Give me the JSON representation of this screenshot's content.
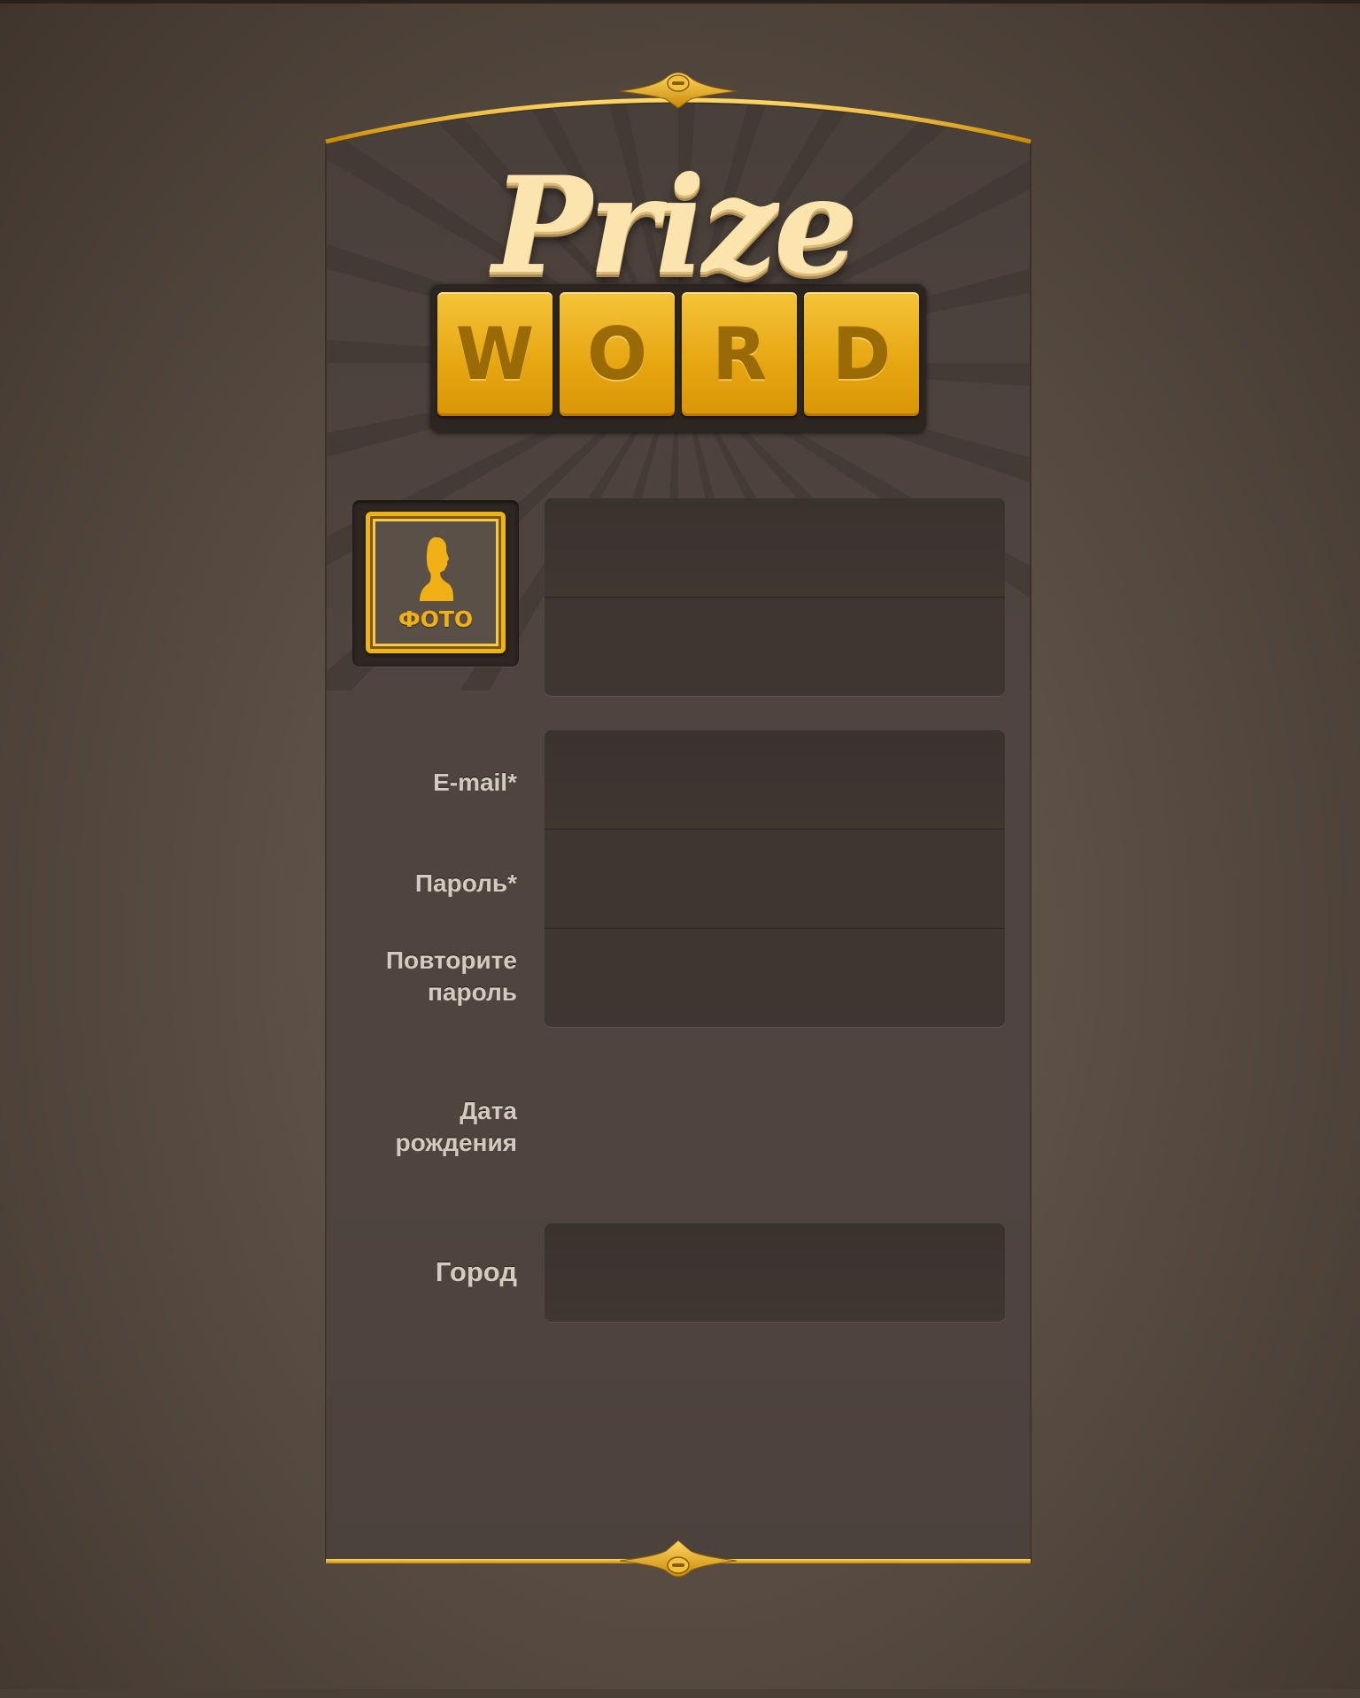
{
  "app": {
    "title": "Prize WORD"
  },
  "logo": {
    "script_text": "Prize",
    "tiles": [
      "W",
      "O",
      "R",
      "D"
    ]
  },
  "photo": {
    "label": "ФОТО"
  },
  "fields": {
    "first_name": {
      "value": "",
      "placeholder": ""
    },
    "last_name": {
      "value": "",
      "placeholder": ""
    },
    "email": {
      "label": "E-mail*",
      "value": "",
      "placeholder": ""
    },
    "password": {
      "label": "Пароль*",
      "value": "",
      "placeholder": ""
    },
    "password_repeat": {
      "label_line1": "Повторите",
      "label_line2": "пароль",
      "value": "",
      "placeholder": ""
    },
    "birth_date": {
      "label_line1": "Дата",
      "label_line2": "рождения"
    },
    "city": {
      "label": "Город",
      "value": "",
      "placeholder": ""
    }
  },
  "colors": {
    "accent_gold": "#f0b316",
    "panel": "#4a403a",
    "field_bg": "#3e3631",
    "label_text": "#d4cabf"
  }
}
